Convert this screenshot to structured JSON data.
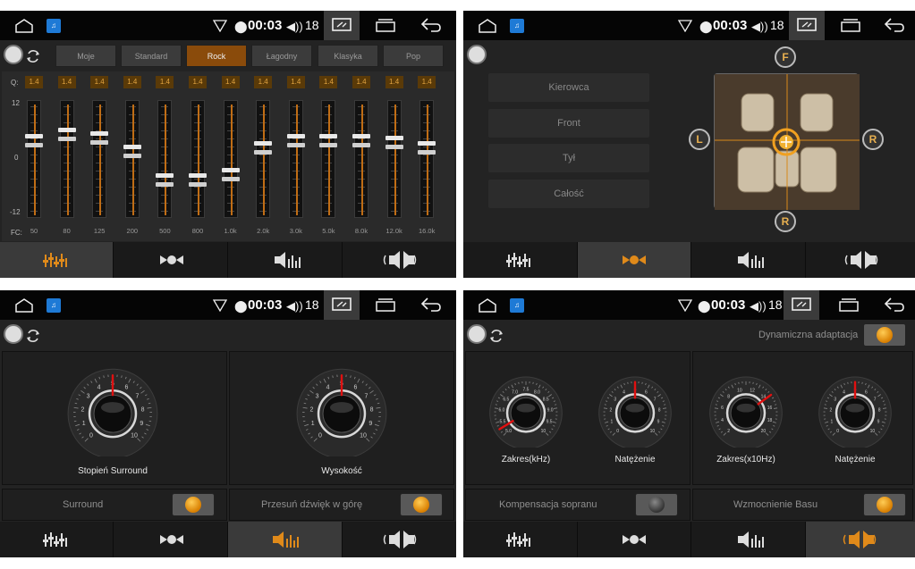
{
  "status_bar": {
    "time": "00:03",
    "volume": "18"
  },
  "equalizer": {
    "presets": [
      "Moje",
      "Standard",
      "Rock",
      "Łagodny",
      "Klasyka",
      "Pop"
    ],
    "active_preset": "Rock",
    "q_label": "Q:",
    "fc_label": "FC:",
    "scale_top": "12",
    "scale_mid": "0",
    "scale_bottom": "-12",
    "q_values": [
      "1.4",
      "1.4",
      "1.4",
      "1.4",
      "1.4",
      "1.4",
      "1.4",
      "1.4",
      "1.4",
      "1.4",
      "1.4",
      "1.4",
      "1.4"
    ],
    "fc_values": [
      "50",
      "80",
      "125",
      "200",
      "500",
      "800",
      "1.0k",
      "2.0k",
      "3.0k",
      "5.0k",
      "8.0k",
      "12.0k",
      "16.0k"
    ],
    "gain_levels": [
      0.28,
      0.22,
      0.25,
      0.38,
      0.65,
      0.65,
      0.6,
      0.35,
      0.28,
      0.28,
      0.28,
      0.3,
      0.35
    ]
  },
  "balance": {
    "zones": [
      "Kierowca",
      "Front",
      "Tył",
      "Całość"
    ],
    "badges": {
      "front": "F",
      "left": "L",
      "right": "R",
      "rear": "R"
    }
  },
  "surround": {
    "dial_left_label": "Stopień Surround",
    "dial_right_label": "Wysokość",
    "dial_ticks": [
      "0",
      "1",
      "2",
      "3",
      "4",
      "5",
      "6",
      "7",
      "8",
      "9",
      "10"
    ],
    "switch_left_label": "Surround",
    "switch_right_label": "Przesuń dźwięk w górę"
  },
  "bass_treble": {
    "dynamic_label": "Dynamiczna adaptacja",
    "dial1_label": "Zakres(kHz)",
    "dial2_label": "Natężenie",
    "dial3_label": "Zakres(x10Hz)",
    "dial4_label": "Natężenie",
    "dial1_ticks": [
      "5.0",
      "5.5",
      "6.0",
      "6.5",
      "7.0",
      "7.5",
      "8.0",
      "8.5",
      "9.0",
      "9.5",
      "10"
    ],
    "dial3_ticks": [
      "2",
      "4",
      "6",
      "8",
      "10",
      "12",
      "14",
      "16",
      "18",
      "20"
    ],
    "switch_left_label": "Kompensacja sopranu",
    "switch_right_label": "Wzmocnienie Basu"
  },
  "colors": {
    "accent": "#d87e00",
    "panel_bg": "#232323",
    "status_bg": "#050505"
  }
}
